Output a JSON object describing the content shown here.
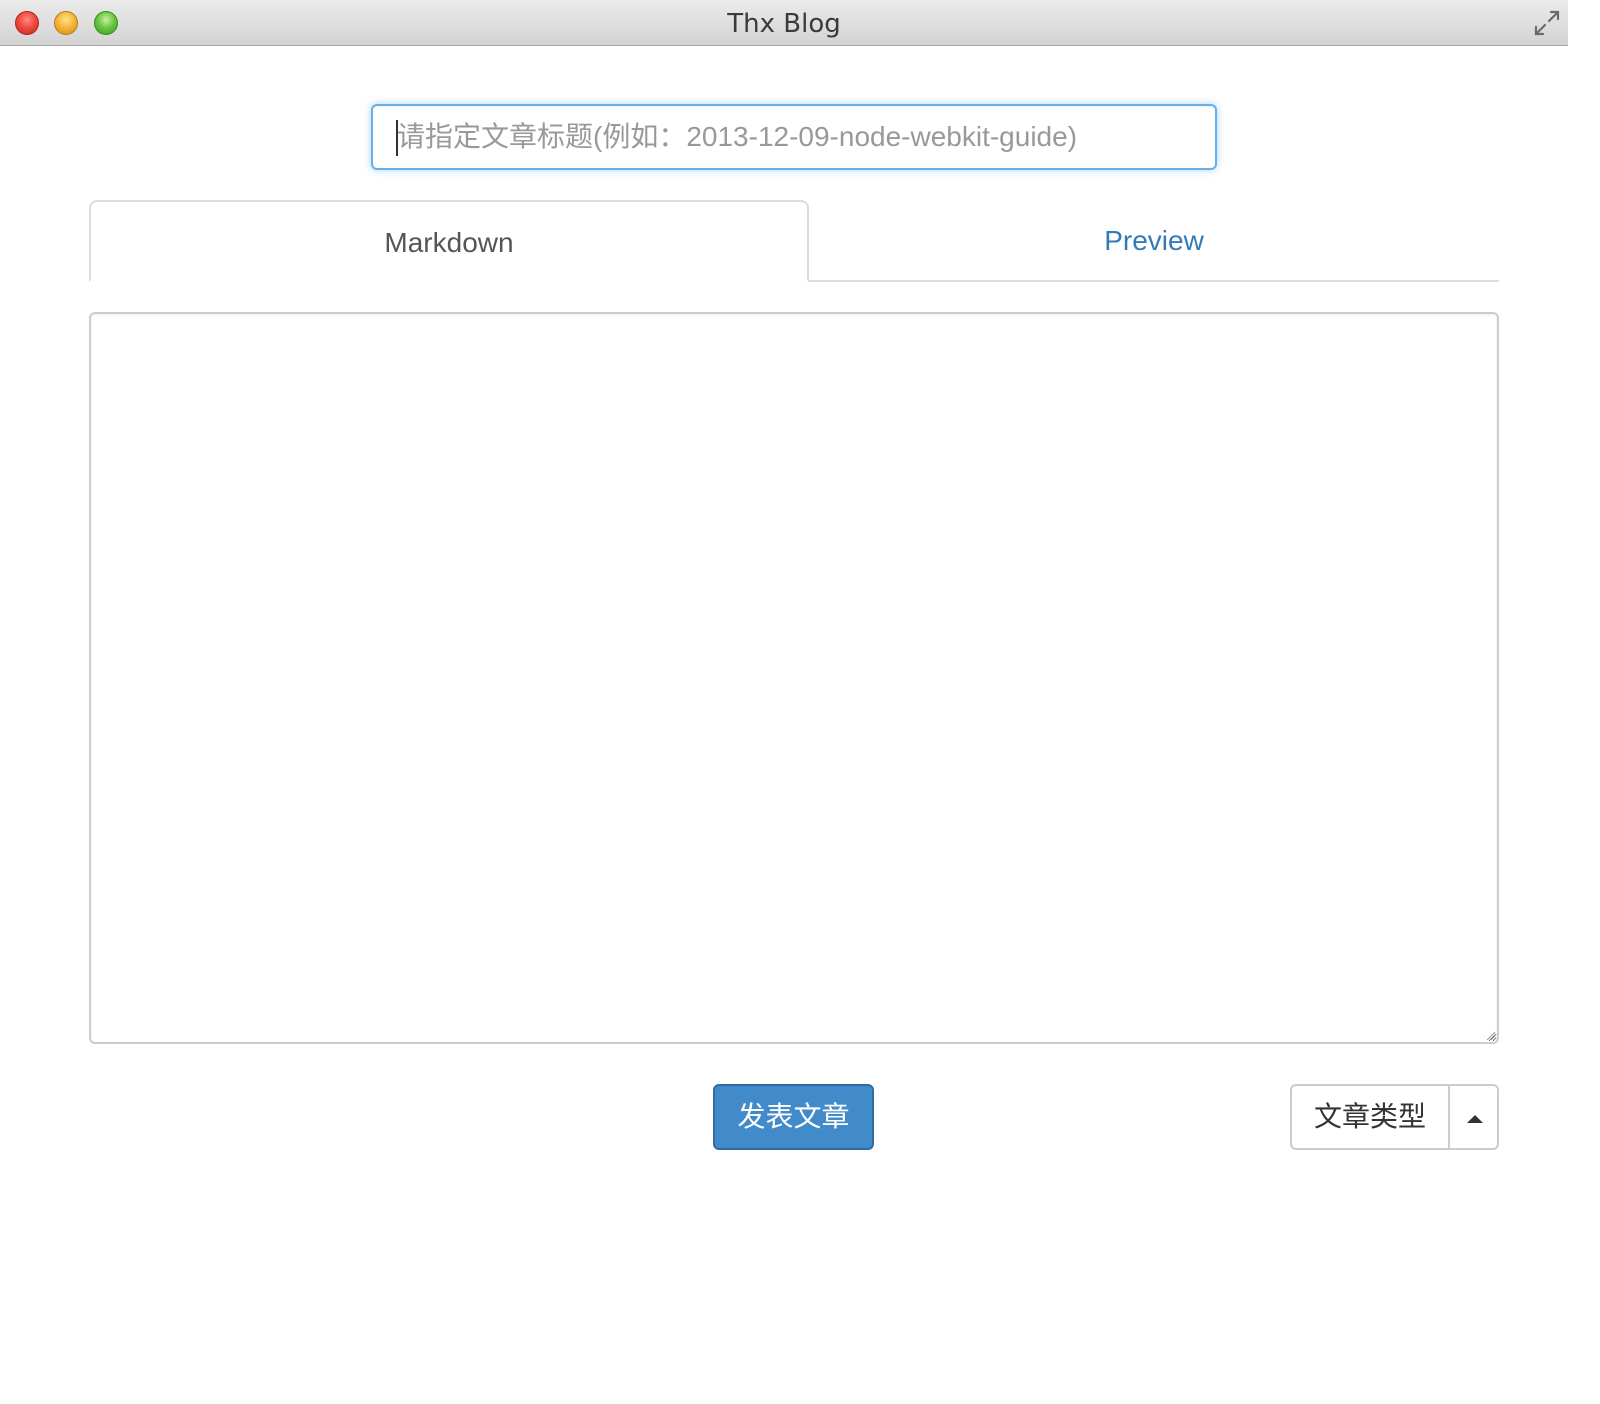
{
  "window": {
    "title": "Thx Blog"
  },
  "title_input": {
    "placeholder": "请指定文章标题(例如：2013-12-09-node-webkit-guide)",
    "value": ""
  },
  "tabs": [
    {
      "label": "Markdown",
      "active": true
    },
    {
      "label": "Preview",
      "active": false
    }
  ],
  "editor": {
    "value": ""
  },
  "actions": {
    "publish_label": "发表文章",
    "type_label": "文章类型"
  },
  "icons": {
    "close": "close-icon",
    "minimize": "minimize-icon",
    "zoom": "zoom-icon",
    "fullscreen": "fullscreen-icon",
    "dropdown": "caret-up-icon"
  },
  "colors": {
    "accent": "#428bca",
    "link": "#337ab7",
    "focus": "#66afe9"
  }
}
